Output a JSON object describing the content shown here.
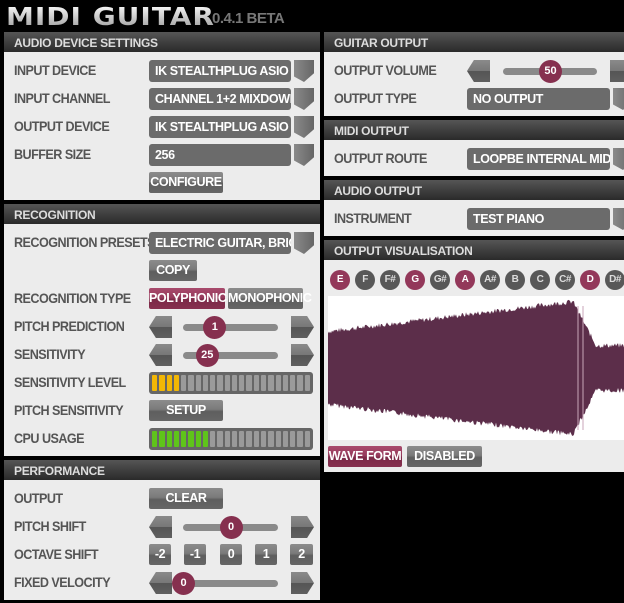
{
  "app": {
    "title": "MIDI GUITAR",
    "version": "0.4.1 BETA"
  },
  "accent": "#86304f",
  "audio_device": {
    "header": "AUDIO DEVICE SETTINGS",
    "input_device": {
      "label": "INPUT DEVICE",
      "value": "IK STEALTHPLUG ASIO DRI..."
    },
    "input_channel": {
      "label": "INPUT CHANNEL",
      "value": "CHANNEL 1+2 MIXDOWN"
    },
    "output_device": {
      "label": "OUTPUT DEVICE",
      "value": "IK STEALTHPLUG ASIO DRI..."
    },
    "buffer_size": {
      "label": "BUFFER SIZE",
      "value": "256"
    },
    "configure": "CONFIGURE"
  },
  "recognition": {
    "header": "RECOGNITION",
    "presets": {
      "label": "RECOGNITION PRESETS",
      "value": "ELECTRIC GUITAR, BRIGHT..."
    },
    "copy": "COPY",
    "type": {
      "label": "RECOGNITION TYPE",
      "options": [
        "POLYPHONIC",
        "MONOPHONIC"
      ],
      "selected": "POLYPHONIC"
    },
    "pitch_prediction": {
      "label": "PITCH PREDICTION",
      "value": "1",
      "level": 0.33
    },
    "sensitivity": {
      "label": "SENSITIVITY",
      "value": "25",
      "level": 0.25
    },
    "sensitivity_level": {
      "label": "SENSITIVITY LEVEL",
      "lit": 4,
      "segments": 22,
      "color": "#f2b705"
    },
    "pitch_sensitivity": {
      "label": "PITCH SENSITIVITY",
      "button": "SETUP"
    },
    "cpu_usage": {
      "label": "CPU USAGE",
      "lit": 8,
      "segments": 22,
      "color": "#5fc41a"
    }
  },
  "performance": {
    "header": "PERFORMANCE",
    "output": {
      "label": "OUTPUT",
      "button": "CLEAR"
    },
    "pitch_shift": {
      "label": "PITCH SHIFT",
      "value": "0",
      "level": 0.5
    },
    "octave_shift": {
      "label": "OCTAVE SHIFT",
      "options": [
        "-2",
        "-1",
        "0",
        "1",
        "2"
      ]
    },
    "fixed_velocity": {
      "label": "FIXED VELOCITY",
      "value": "0",
      "level": 0.0
    }
  },
  "guitar_output": {
    "header": "GUITAR OUTPUT",
    "volume": {
      "label": "OUTPUT VOLUME",
      "value": "50",
      "level": 0.5
    },
    "type": {
      "label": "OUTPUT TYPE",
      "value": "NO OUTPUT"
    }
  },
  "midi_output": {
    "header": "MIDI OUTPUT",
    "route": {
      "label": "OUTPUT ROUTE",
      "value": "LOOPBE INTERNAL MIDI"
    }
  },
  "audio_output": {
    "header": "AUDIO OUTPUT",
    "instrument": {
      "label": "INSTRUMENT",
      "value": "TEST PIANO"
    }
  },
  "visualisation": {
    "header": "OUTPUT VISUALISATION",
    "notes": [
      {
        "n": "E",
        "on": true
      },
      {
        "n": "F",
        "on": false
      },
      {
        "n": "F#",
        "on": false
      },
      {
        "n": "G",
        "on": true
      },
      {
        "n": "G#",
        "on": false
      },
      {
        "n": "A",
        "on": true
      },
      {
        "n": "A#",
        "on": false
      },
      {
        "n": "B",
        "on": false
      },
      {
        "n": "C",
        "on": false
      },
      {
        "n": "C#",
        "on": false
      },
      {
        "n": "D",
        "on": true
      },
      {
        "n": "D#",
        "on": false
      }
    ],
    "wave_color": "#5c2e4a",
    "modes": [
      "WAVE FORM",
      "DISABLED"
    ],
    "selected_mode": "WAVE FORM"
  }
}
